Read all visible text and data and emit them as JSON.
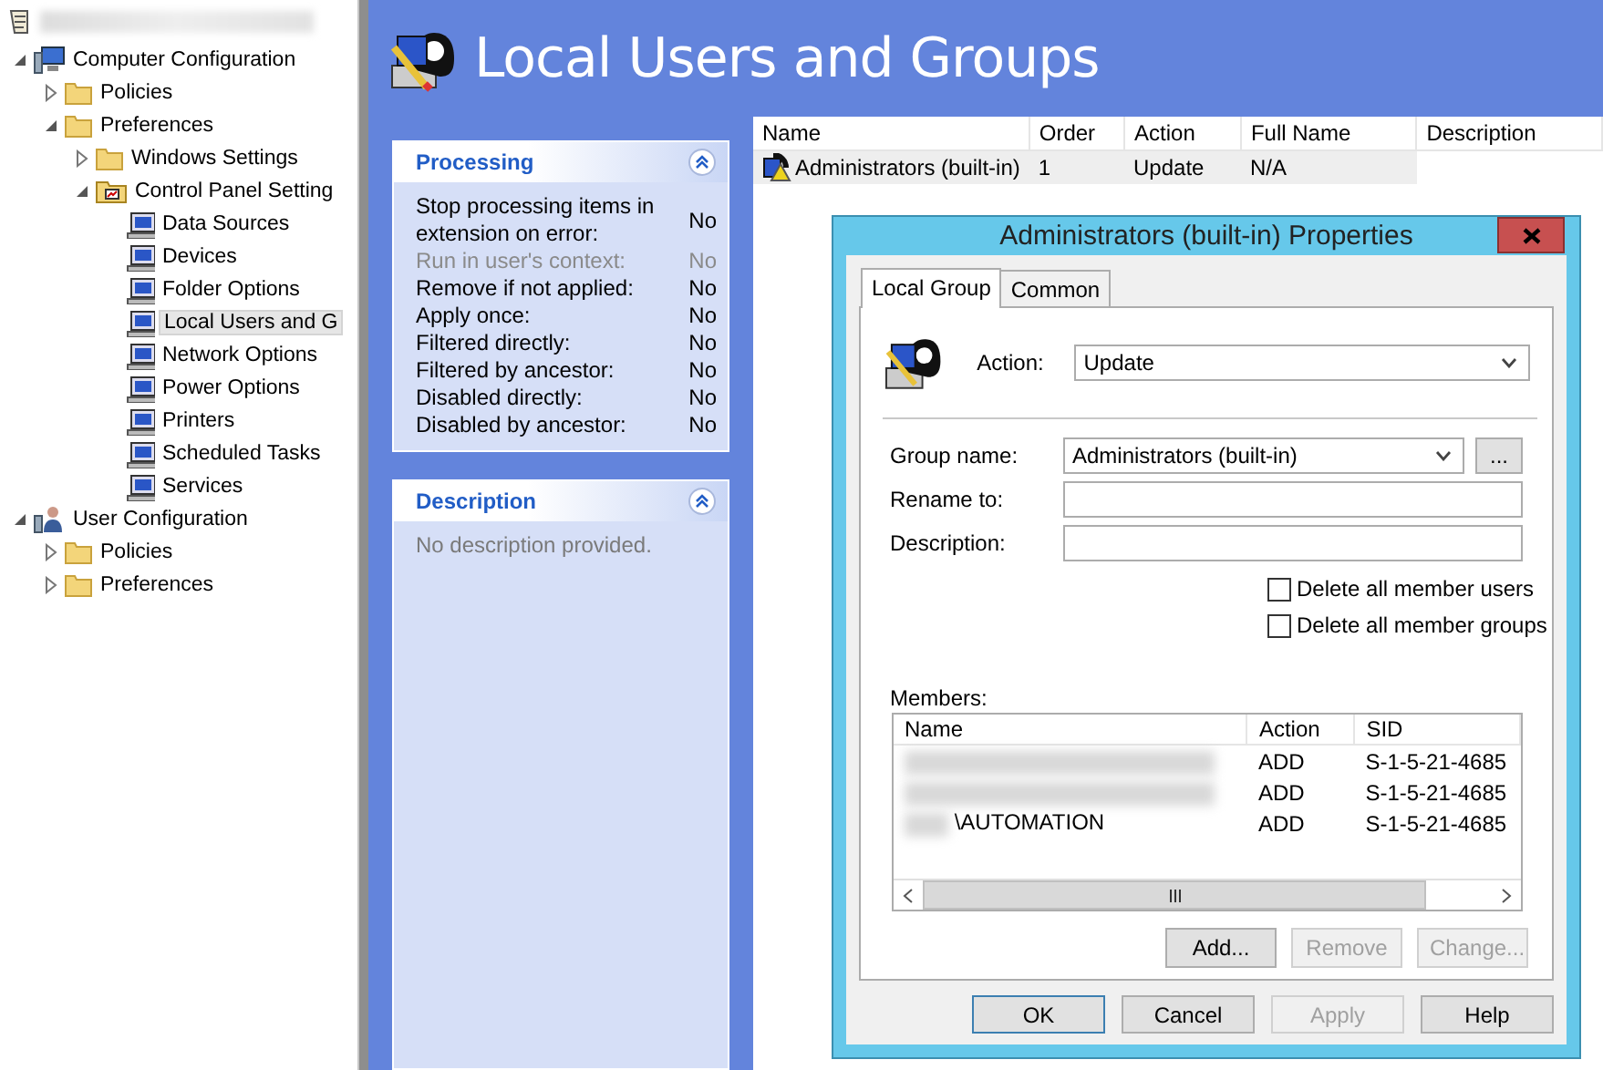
{
  "tree": {
    "items": [
      {
        "label": "Computer Configuration",
        "kind": "computer",
        "expanded": true,
        "selected": false,
        "children": [
          {
            "label": "Policies",
            "kind": "folder",
            "expanded": false,
            "selected": false
          },
          {
            "label": "Preferences",
            "kind": "folder",
            "expanded": true,
            "selected": false,
            "children": [
              {
                "label": "Windows Settings",
                "kind": "folder",
                "expanded": false,
                "selected": false
              },
              {
                "label": "Control Panel Setting",
                "kind": "control-panel",
                "expanded": true,
                "selected": false,
                "children": [
                  {
                    "label": "Data Sources",
                    "kind": "leaf",
                    "selected": false
                  },
                  {
                    "label": "Devices",
                    "kind": "leaf",
                    "selected": false
                  },
                  {
                    "label": "Folder Options",
                    "kind": "leaf",
                    "selected": false
                  },
                  {
                    "label": "Local Users and G",
                    "kind": "leaf",
                    "selected": true
                  },
                  {
                    "label": "Network Options",
                    "kind": "leaf",
                    "selected": false
                  },
                  {
                    "label": "Power Options",
                    "kind": "leaf",
                    "selected": false
                  },
                  {
                    "label": "Printers",
                    "kind": "leaf",
                    "selected": false
                  },
                  {
                    "label": "Scheduled Tasks",
                    "kind": "leaf",
                    "selected": false
                  },
                  {
                    "label": "Services",
                    "kind": "leaf",
                    "selected": false
                  }
                ]
              }
            ]
          }
        ]
      },
      {
        "label": "User Configuration",
        "kind": "user",
        "expanded": true,
        "selected": false,
        "children": [
          {
            "label": "Policies",
            "kind": "folder",
            "expanded": false,
            "selected": false
          },
          {
            "label": "Preferences",
            "kind": "folder",
            "expanded": false,
            "selected": false
          }
        ]
      }
    ]
  },
  "header": {
    "title": "Local Users and Groups"
  },
  "panels": [
    {
      "title": "Processing",
      "rows": [
        {
          "label": "Stop processing items in extension on error:",
          "value": "No",
          "disabled": false
        },
        {
          "label": "Run in user's context:",
          "value": "No",
          "disabled": true
        },
        {
          "label": "Remove if not applied:",
          "value": "No",
          "disabled": false
        },
        {
          "label": "Apply once:",
          "value": "No",
          "disabled": false
        },
        {
          "label": "Filtered directly:",
          "value": "No",
          "disabled": false
        },
        {
          "label": "Filtered by ancestor:",
          "value": "No",
          "disabled": false
        },
        {
          "label": "Disabled directly:",
          "value": "No",
          "disabled": false
        },
        {
          "label": "Disabled by ancestor:",
          "value": "No",
          "disabled": false
        }
      ]
    },
    {
      "title": "Description",
      "text": "No description provided."
    }
  ],
  "list": {
    "columns": [
      "Name",
      "Order",
      "Action",
      "Full Name",
      "Description"
    ],
    "rows": [
      {
        "cells": [
          "Administrators (built-in)",
          "1",
          "Update",
          "N/A"
        ],
        "selected": true
      }
    ]
  },
  "dialog": {
    "title": "Administrators (built-in) Properties",
    "tabs": [
      {
        "label": "Local Group",
        "selected": true
      },
      {
        "label": "Common",
        "selected": false
      }
    ],
    "action": {
      "label": "Action:",
      "value": "Update"
    },
    "fields": [
      {
        "kind": "dropdown",
        "label": "Group name:",
        "value": "Administrators (built-in)",
        "button": "..."
      },
      {
        "kind": "text",
        "label": "Rename to:"
      },
      {
        "kind": "text",
        "label": "Description:"
      }
    ],
    "checkboxes": [
      {
        "label": "Delete all member users",
        "checked": false
      },
      {
        "label": "Delete all member groups",
        "checked": false
      }
    ],
    "members": {
      "label": "Members:",
      "columns": [
        "Name",
        "Action",
        "SID"
      ],
      "rows": [
        {
          "action": "ADD",
          "sid": "S-1-5-21-4685"
        },
        {
          "action": "ADD",
          "sid": "S-1-5-21-4685"
        },
        {
          "name": "\\AUTOMATION",
          "action": "ADD",
          "sid": "S-1-5-21-4685"
        }
      ],
      "buttons": [
        {
          "label": "Add...",
          "disabled": false
        },
        {
          "label": "Remove",
          "disabled": true
        },
        {
          "label": "Change...",
          "disabled": true
        }
      ]
    },
    "buttons": [
      {
        "label": "OK",
        "disabled": false,
        "default": true
      },
      {
        "label": "Cancel",
        "disabled": false,
        "default": false
      },
      {
        "label": "Apply",
        "disabled": true,
        "default": false
      },
      {
        "label": "Help",
        "disabled": false,
        "default": false
      }
    ]
  }
}
